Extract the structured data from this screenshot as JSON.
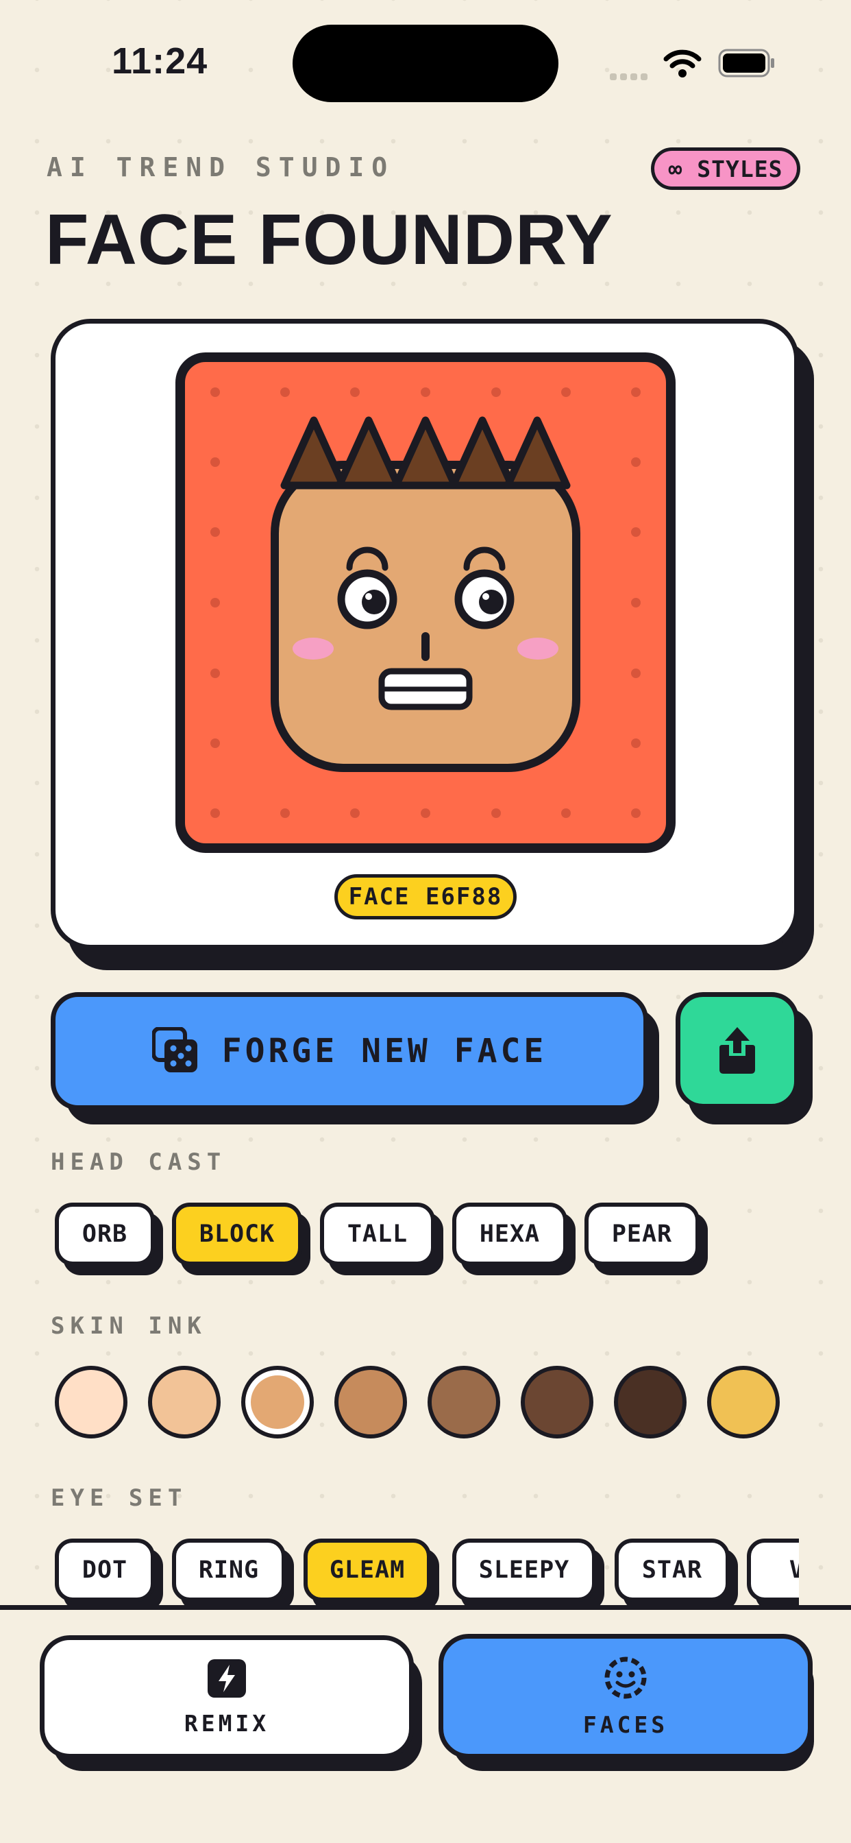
{
  "status": {
    "time": "11:24"
  },
  "header": {
    "eyebrow": "AI TREND STUDIO",
    "title": "FACE FOUNDRY",
    "styles_badge": "∞ STYLES"
  },
  "card": {
    "face_id": "FACE E6F88",
    "background_color": "#ff6b4a",
    "skin_color": "#e3a873",
    "hair_color": "#6b3f22",
    "blush_color": "#f6a0c4"
  },
  "actions": {
    "forge_label": "FORGE NEW FACE",
    "dice_icon": "dice-icon",
    "share_icon": "share-icon"
  },
  "head_cast": {
    "label": "HEAD CAST",
    "options": [
      "ORB",
      "BLOCK",
      "TALL",
      "HEXA",
      "PEAR"
    ],
    "selected": "BLOCK"
  },
  "skin_ink": {
    "label": "SKIN INK",
    "swatches": [
      "#ffdfc6",
      "#f2c397",
      "#e3a873",
      "#c68b5c",
      "#9a6b4a",
      "#6b4632",
      "#4a3024",
      "#f0c154"
    ],
    "selected_index": 2
  },
  "eye_set": {
    "label": "EYE SET",
    "options": [
      "DOT",
      "RING",
      "GLEAM",
      "SLEEPY",
      "STAR",
      "VI"
    ],
    "selected": "GLEAM"
  },
  "nav": {
    "remix": "REMIX",
    "faces": "FACES",
    "active": "FACES"
  },
  "colors": {
    "accent_blue": "#4b98fb",
    "accent_green": "#2fd898",
    "accent_yellow": "#fcd01f",
    "accent_pink": "#f794c6",
    "ink": "#1b1a22",
    "background": "#f5efe1"
  }
}
